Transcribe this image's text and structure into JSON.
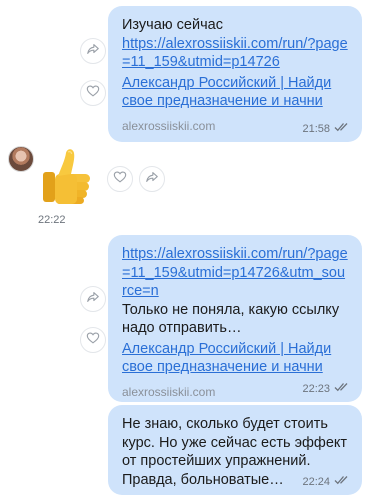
{
  "messages": {
    "m1": {
      "text": "Изучаю сейчас",
      "url": "https://alexrossiiskii.com/run/?page=11_159&utmid=p14726",
      "preview_title": "Александр Российский | Найди свое предназначение и начни",
      "domain": "alexrossiiskii.com",
      "time": "21:58"
    },
    "m2": {
      "time": "22:22"
    },
    "m3": {
      "url": "https://alexrossiiskii.com/run/?page=11_159&utmid=p14726&utm_source=n",
      "text": "Только не поняла, какую ссылку надо отправить…",
      "preview_title": "Александр Российский | Найди свое предназначение и начни",
      "domain": "alexrossiiskii.com",
      "time": "22:23"
    },
    "m4": {
      "text": "Не знаю, сколько будет стоить курс. Но уже сейчас есть эффект от простейших упражнений. Правда, больноватые…",
      "time": "22:24"
    }
  },
  "colors": {
    "outgoing_bubble": "#cfe3fb",
    "link": "#2a6fd6"
  },
  "icons": [
    "share-icon",
    "heart-icon",
    "double-check-icon",
    "thumbs-up-sticker"
  ]
}
